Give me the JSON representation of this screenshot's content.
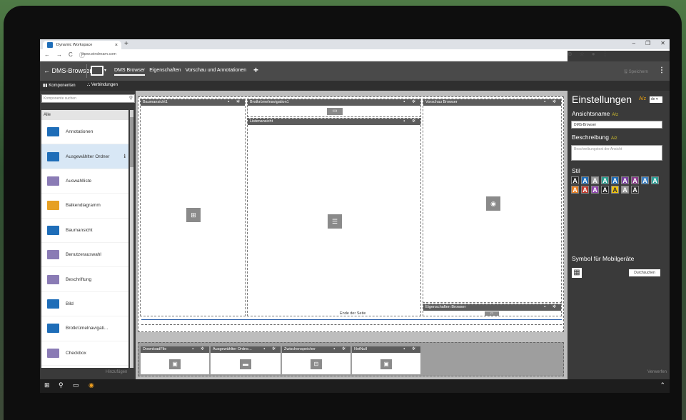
{
  "browser": {
    "tab_title": "Dynamic Workspace",
    "tab_close": "×",
    "new_tab": "+",
    "url": "www.windream.com",
    "nav": [
      "←",
      "→",
      "C",
      "ⓘ"
    ],
    "right_icons": [
      "⊕",
      "☆",
      "●",
      "⋮"
    ],
    "window_controls": [
      "–",
      "❐",
      "✕"
    ]
  },
  "app": {
    "back_label": "← DMS-Browser",
    "view_dropdown": "▾",
    "tabs": [
      "DMS Browser",
      "Eigenschaften",
      "Vorschau und Annotationen"
    ],
    "add": "+",
    "save_label": "🖫 Speichern",
    "more": "⋮"
  },
  "subtoolbar": {
    "components_label": "Komponenten",
    "connections_label": "Verbindungen"
  },
  "left_panel": {
    "search_placeholder": "Komponente suchen",
    "search_icon": "⚲",
    "category": "Alle",
    "items": [
      {
        "label": "Annotationen",
        "color": "#1e6db8",
        "icon": "annotation-icon",
        "selected": false
      },
      {
        "label": "Ausgewählter Ordner",
        "color": "#1e6db8",
        "icon": "folder-icon",
        "selected": true,
        "info": "ℹ"
      },
      {
        "label": "Auswahlliste",
        "color": "#8a7bb5",
        "icon": "dropdown-icon",
        "selected": false
      },
      {
        "label": "Balkendiagramm",
        "color": "#e6a023",
        "icon": "bar-chart-icon",
        "selected": false
      },
      {
        "label": "Baumansicht",
        "color": "#1e6db8",
        "icon": "tree-icon",
        "selected": false
      },
      {
        "label": "Benutzerauswahl",
        "color": "#8a7bb5",
        "icon": "user-select-icon",
        "selected": false
      },
      {
        "label": "Beschriftung",
        "color": "#8a7bb5",
        "icon": "label-icon",
        "selected": false
      },
      {
        "label": "Bild",
        "color": "#1e6db8",
        "icon": "image-icon",
        "selected": false
      },
      {
        "label": "Brotkrümelnavigati...",
        "color": "#1e6db8",
        "icon": "breadcrumb-icon",
        "selected": false
      },
      {
        "label": "Checkbox",
        "color": "#8a7bb5",
        "icon": "checkbox-icon",
        "selected": false
      }
    ],
    "add_button": "Hinzufügen"
  },
  "canvas": {
    "tree": {
      "title": "Baumansicht1",
      "icon": "⊞"
    },
    "breadcrumb": {
      "title": "Brotkrümelnavigation1",
      "icon": "▭"
    },
    "list": {
      "title": "Listenansicht",
      "icon": "☰"
    },
    "preview": {
      "title": "Vorschau Browser",
      "icon": "◉"
    },
    "properties": {
      "title": "Eigenschaften Browser",
      "icon": "▭"
    },
    "end_of_page": "Ende der Seite",
    "bottom": [
      {
        "title": "DownloadFile",
        "icon": "▣"
      },
      {
        "title": "Ausgewählter Ordne...",
        "icon": "▬"
      },
      {
        "title": "Zwischenspeicher",
        "icon": "⊟"
      },
      {
        "title": "NotNull",
        "icon": "▣"
      }
    ],
    "header_actions": "▪ ✲"
  },
  "settings": {
    "title": "Einstellungen",
    "translate_icon": "A/z",
    "language": "de ▾",
    "name_label": "Ansichtsname",
    "name_icon": "A/z",
    "name_value": "DMS-Browser",
    "description_label": "Beschreibung",
    "description_placeholder": "Beschreibungstext der Ansicht",
    "style_label": "Stil",
    "swatches": [
      {
        "bg": "#2b2b2b",
        "fg": "#ffffff"
      },
      {
        "bg": "#1e6db8",
        "fg": "#ffffff"
      },
      {
        "bg": "#9a9a9a",
        "fg": "#ffffff"
      },
      {
        "bg": "#2a9d8f",
        "fg": "#ffffff"
      },
      {
        "bg": "#1e6db8",
        "fg": "#ffffff"
      },
      {
        "bg": "#7b3fa0",
        "fg": "#ffffff"
      },
      {
        "bg": "#8a3a8a",
        "fg": "#ffffff"
      },
      {
        "bg": "#3a7fc2",
        "fg": "#ffffff"
      },
      {
        "bg": "#2aa198",
        "fg": "#ffffff"
      },
      {
        "bg": "#e67e22",
        "fg": "#ffffff"
      },
      {
        "bg": "#c0392b",
        "fg": "#ffffff"
      },
      {
        "bg": "#8e44ad",
        "fg": "#ffffff"
      },
      {
        "bg": "#222222",
        "fg": "#ffffff"
      },
      {
        "bg": "#f1c40f",
        "fg": "#333333"
      },
      {
        "bg": "#999999",
        "fg": "#ffffff"
      },
      {
        "bg": "#333333",
        "fg": "#ffffff"
      }
    ],
    "swatch_letter": "A",
    "mobile_icon_label": "Symbol für Mobilgeräte",
    "mobile_icon": "▦",
    "browse_button": "Durchsuchen",
    "apply_button": "Verwerfen"
  },
  "taskbar": {
    "items": [
      "⊞",
      "⚲",
      "▭",
      "◉"
    ],
    "tray": "⌃"
  }
}
